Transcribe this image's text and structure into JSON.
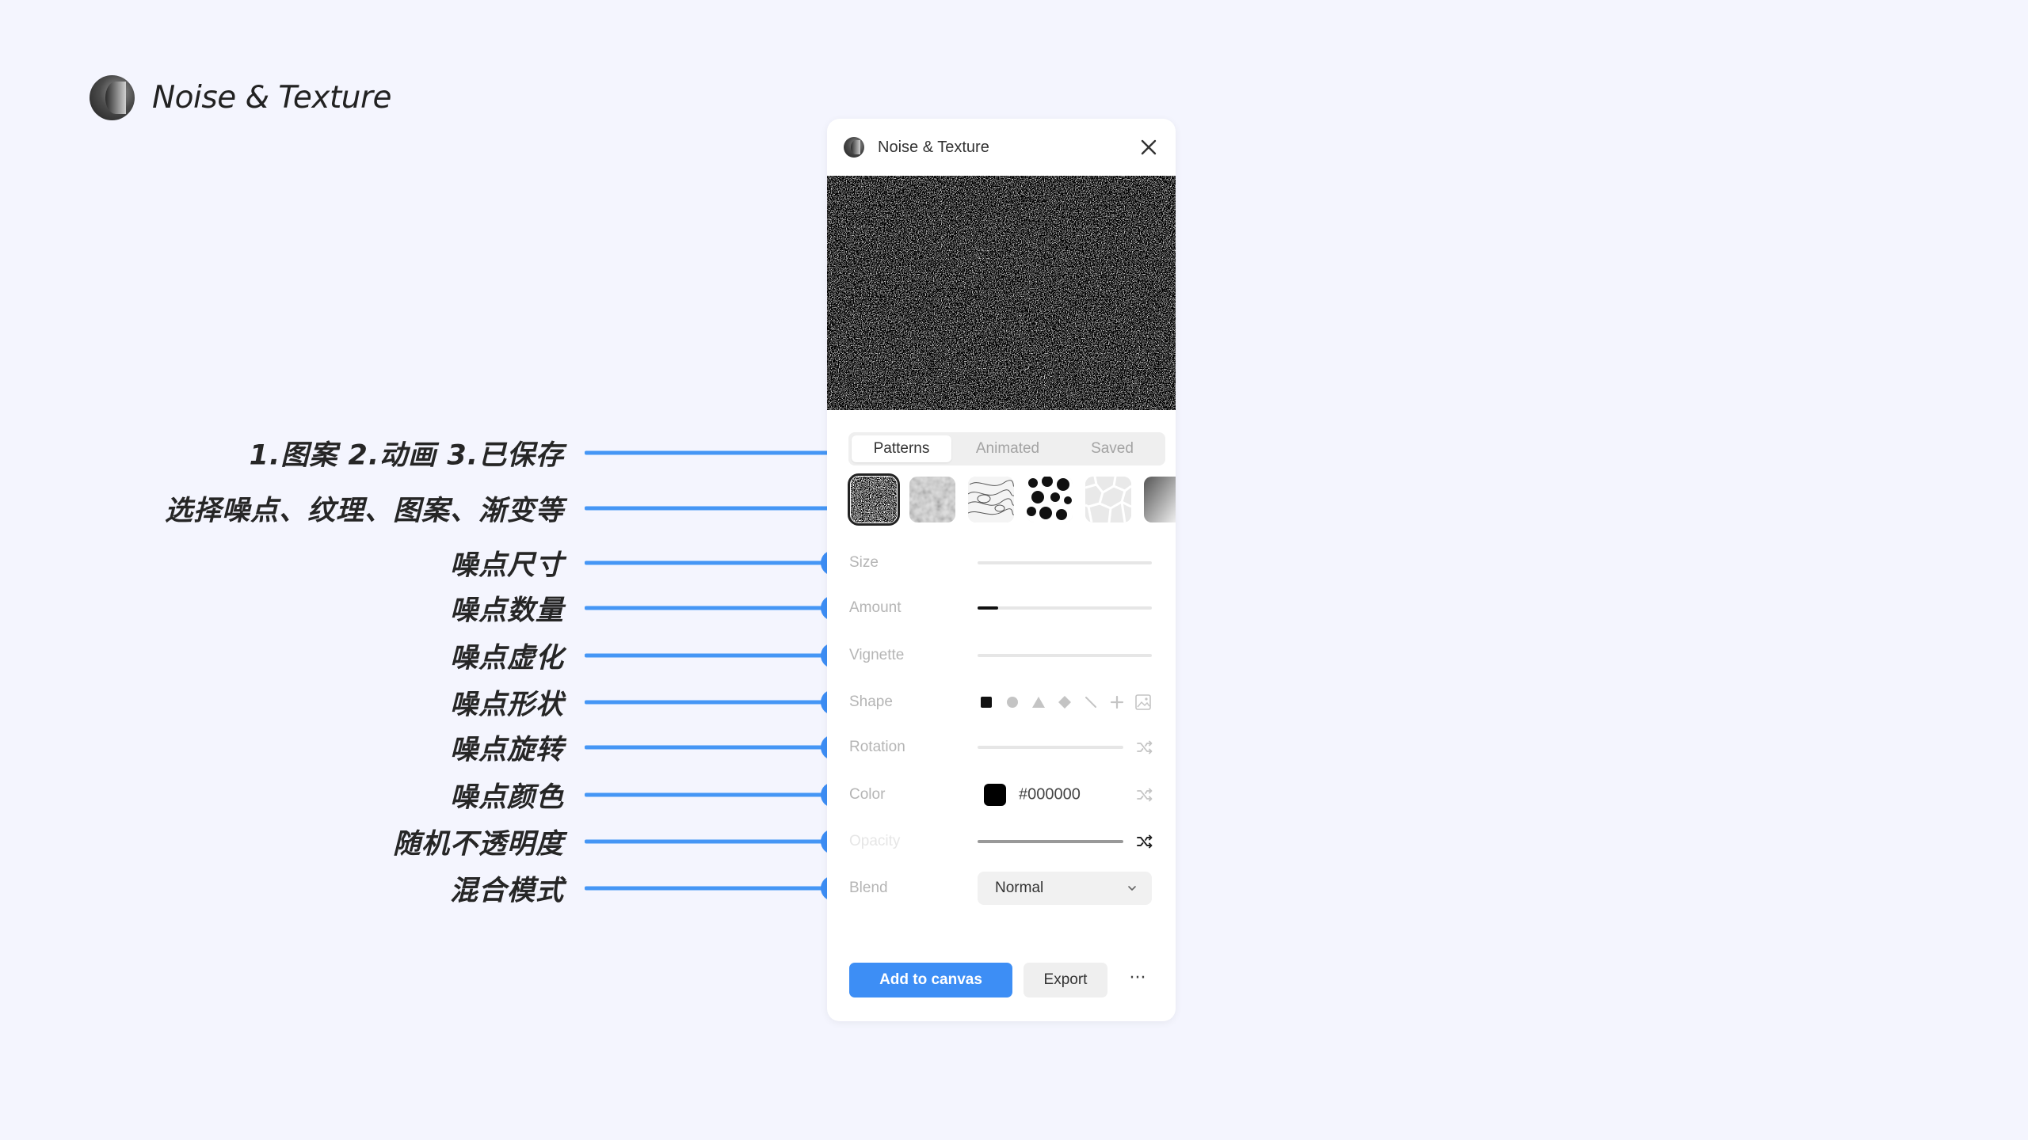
{
  "brand": {
    "title": "Noise & Texture",
    "icon": "noise-texture-logo-icon"
  },
  "annotations": [
    {
      "label": "1.图案 2.动画 3.已保存",
      "target": "tabs"
    },
    {
      "label": "选择噪点、纹理、图案、渐变等",
      "target": "pattern-thumbnails"
    },
    {
      "label": "噪点尺寸",
      "target": "size"
    },
    {
      "label": "噪点数量",
      "target": "amount"
    },
    {
      "label": "噪点虚化",
      "target": "vignette"
    },
    {
      "label": "噪点形状",
      "target": "shape"
    },
    {
      "label": "噪点旋转",
      "target": "rotation"
    },
    {
      "label": "噪点颜色",
      "target": "color"
    },
    {
      "label": "随机不透明度",
      "target": "opacity"
    },
    {
      "label": "混合模式",
      "target": "blend"
    }
  ],
  "panel": {
    "title": "Noise & Texture",
    "tabs": [
      {
        "label": "Patterns",
        "active": true
      },
      {
        "label": "Animated",
        "active": false
      },
      {
        "label": "Saved",
        "active": false
      }
    ],
    "thumbnails": [
      "noise",
      "blur-noise",
      "contour",
      "blobs",
      "cells",
      "gradient"
    ],
    "selected_thumbnail": "noise",
    "controls": {
      "size_label": "Size",
      "amount_label": "Amount",
      "amount_value": 0.12,
      "vignette_label": "Vignette",
      "shape_label": "Shape",
      "shapes": [
        "square",
        "circle",
        "triangle",
        "diamond",
        "line",
        "plus",
        "image"
      ],
      "rotation_label": "Rotation",
      "color_label": "Color",
      "color_value": "#000000",
      "opacity_label": "Opacity",
      "blend_label": "Blend",
      "blend_value": "Normal"
    },
    "buttons": {
      "add_to_canvas": "Add to canvas",
      "export": "Export",
      "more": "···"
    }
  },
  "colors": {
    "accent": "#3d8ef5",
    "background": "#f4f5fe",
    "panel": "#ffffff"
  }
}
